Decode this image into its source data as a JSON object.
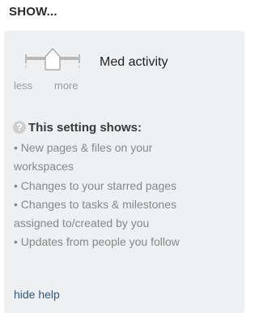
{
  "header": {
    "title": "SHOW..."
  },
  "activity_slider": {
    "level_label": "Med activity",
    "min_label": "less",
    "max_label": "more",
    "level": "medium"
  },
  "help": {
    "icon": "question-circle-icon",
    "heading": "This setting shows:",
    "items": [
      "• New pages & files on your",
      "workspaces",
      "• Changes to your starred pages",
      "• Changes to tasks & milestones",
      "assigned to/created by you",
      "• Updates from people you follow"
    ],
    "hide_label": "hide help"
  },
  "colors": {
    "panel_bg": "#eef0f2",
    "link": "#2f5a84",
    "muted_text": "#888888"
  }
}
